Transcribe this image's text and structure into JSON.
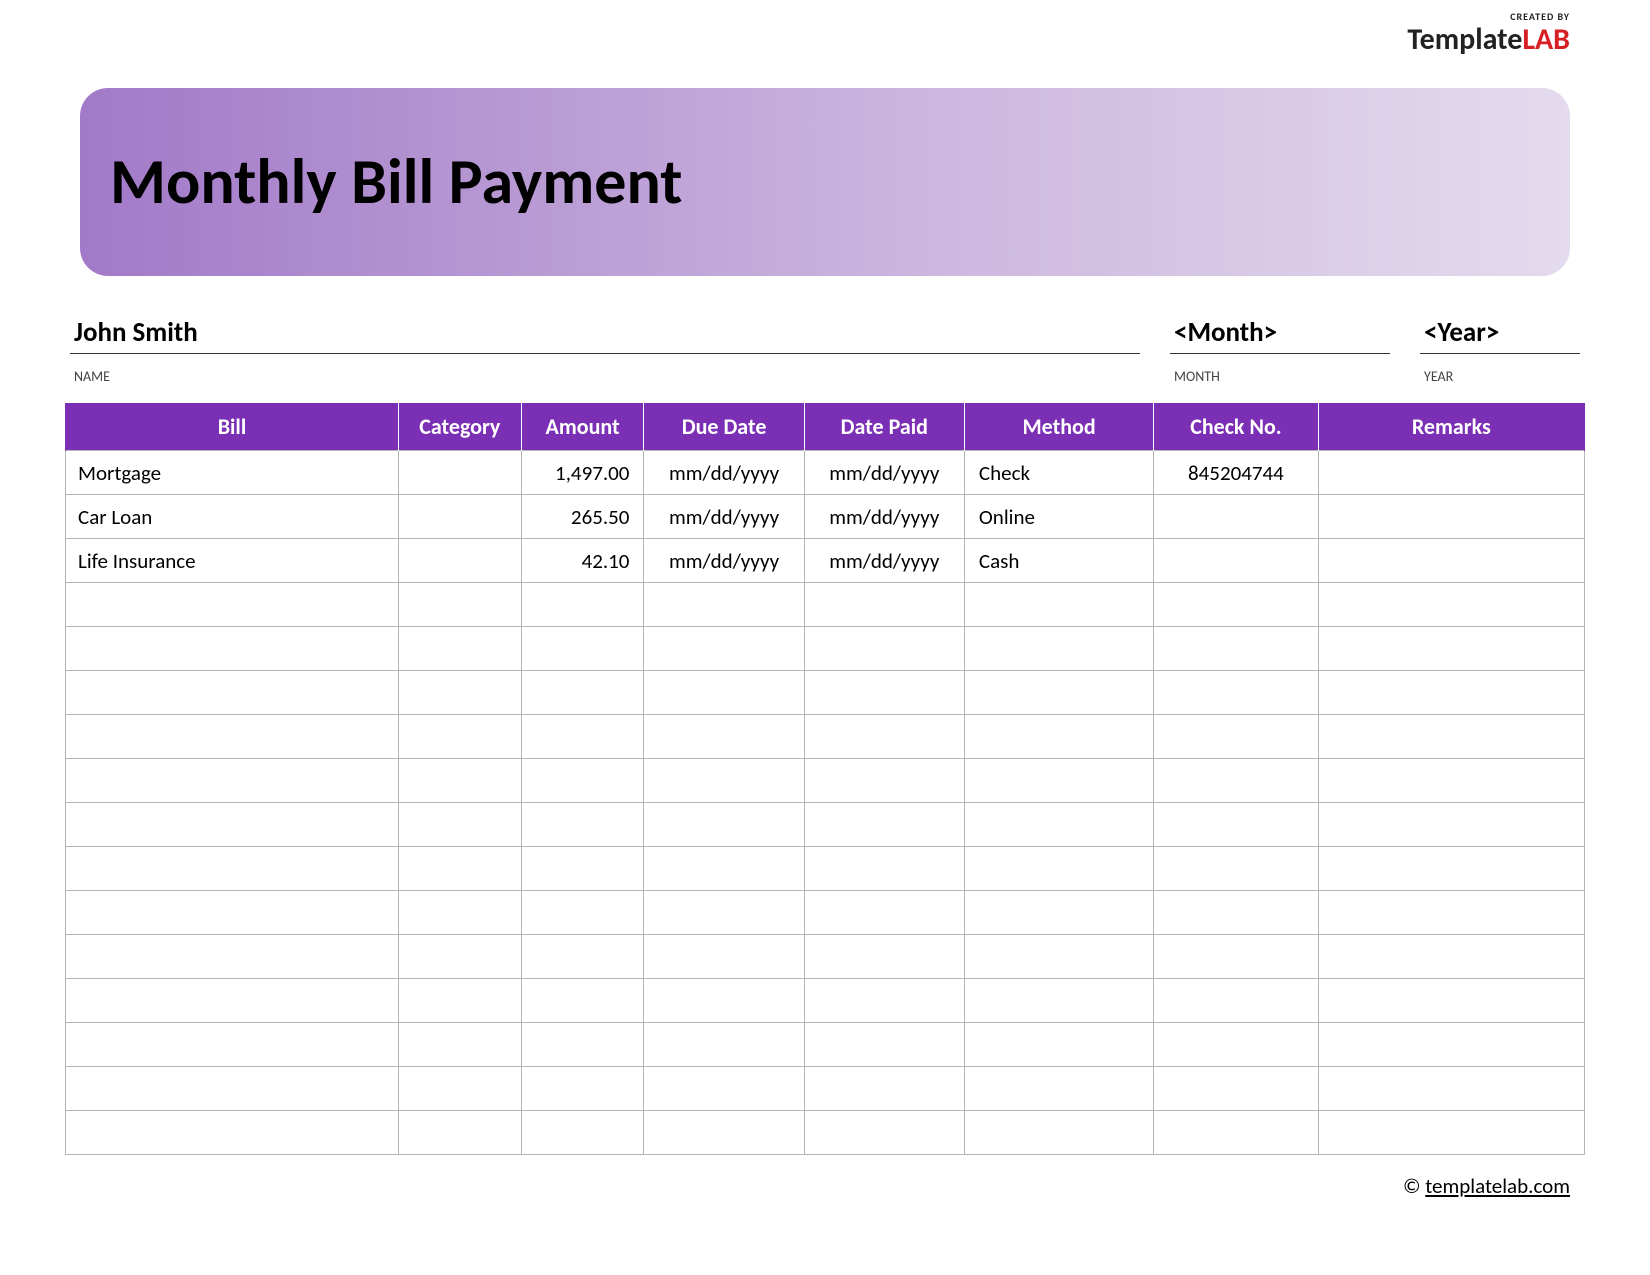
{
  "logo": {
    "created_by": "CREATED BY",
    "name_part1": "Template",
    "name_part2": "LAB"
  },
  "header": {
    "title": "Monthly Bill Payment"
  },
  "meta": {
    "name_value": "John Smith",
    "name_label": "NAME",
    "month_value": "<Month>",
    "month_label": "MONTH",
    "year_value": "<Year>",
    "year_label": "YEAR"
  },
  "columns": {
    "bill": "Bill",
    "category": "Category",
    "amount": "Amount",
    "due_date": "Due Date",
    "date_paid": "Date Paid",
    "method": "Method",
    "check_no": "Check No.",
    "remarks": "Remarks"
  },
  "rows": [
    {
      "bill": "Mortgage",
      "category": "",
      "amount": "1,497.00",
      "due_date": "mm/dd/yyyy",
      "date_paid": "mm/dd/yyyy",
      "method": "Check",
      "check_no": "845204744",
      "remarks": ""
    },
    {
      "bill": "Car Loan",
      "category": "",
      "amount": "265.50",
      "due_date": "mm/dd/yyyy",
      "date_paid": "mm/dd/yyyy",
      "method": "Online",
      "check_no": "",
      "remarks": ""
    },
    {
      "bill": "Life Insurance",
      "category": "",
      "amount": "42.10",
      "due_date": "mm/dd/yyyy",
      "date_paid": "mm/dd/yyyy",
      "method": "Cash",
      "check_no": "",
      "remarks": ""
    },
    {
      "bill": "",
      "category": "",
      "amount": "",
      "due_date": "",
      "date_paid": "",
      "method": "",
      "check_no": "",
      "remarks": ""
    },
    {
      "bill": "",
      "category": "",
      "amount": "",
      "due_date": "",
      "date_paid": "",
      "method": "",
      "check_no": "",
      "remarks": ""
    },
    {
      "bill": "",
      "category": "",
      "amount": "",
      "due_date": "",
      "date_paid": "",
      "method": "",
      "check_no": "",
      "remarks": ""
    },
    {
      "bill": "",
      "category": "",
      "amount": "",
      "due_date": "",
      "date_paid": "",
      "method": "",
      "check_no": "",
      "remarks": ""
    },
    {
      "bill": "",
      "category": "",
      "amount": "",
      "due_date": "",
      "date_paid": "",
      "method": "",
      "check_no": "",
      "remarks": ""
    },
    {
      "bill": "",
      "category": "",
      "amount": "",
      "due_date": "",
      "date_paid": "",
      "method": "",
      "check_no": "",
      "remarks": ""
    },
    {
      "bill": "",
      "category": "",
      "amount": "",
      "due_date": "",
      "date_paid": "",
      "method": "",
      "check_no": "",
      "remarks": ""
    },
    {
      "bill": "",
      "category": "",
      "amount": "",
      "due_date": "",
      "date_paid": "",
      "method": "",
      "check_no": "",
      "remarks": ""
    },
    {
      "bill": "",
      "category": "",
      "amount": "",
      "due_date": "",
      "date_paid": "",
      "method": "",
      "check_no": "",
      "remarks": ""
    },
    {
      "bill": "",
      "category": "",
      "amount": "",
      "due_date": "",
      "date_paid": "",
      "method": "",
      "check_no": "",
      "remarks": ""
    },
    {
      "bill": "",
      "category": "",
      "amount": "",
      "due_date": "",
      "date_paid": "",
      "method": "",
      "check_no": "",
      "remarks": ""
    },
    {
      "bill": "",
      "category": "",
      "amount": "",
      "due_date": "",
      "date_paid": "",
      "method": "",
      "check_no": "",
      "remarks": ""
    },
    {
      "bill": "",
      "category": "",
      "amount": "",
      "due_date": "",
      "date_paid": "",
      "method": "",
      "check_no": "",
      "remarks": ""
    }
  ],
  "footer": {
    "copyright": "©",
    "link_text": "templatelab.com"
  }
}
